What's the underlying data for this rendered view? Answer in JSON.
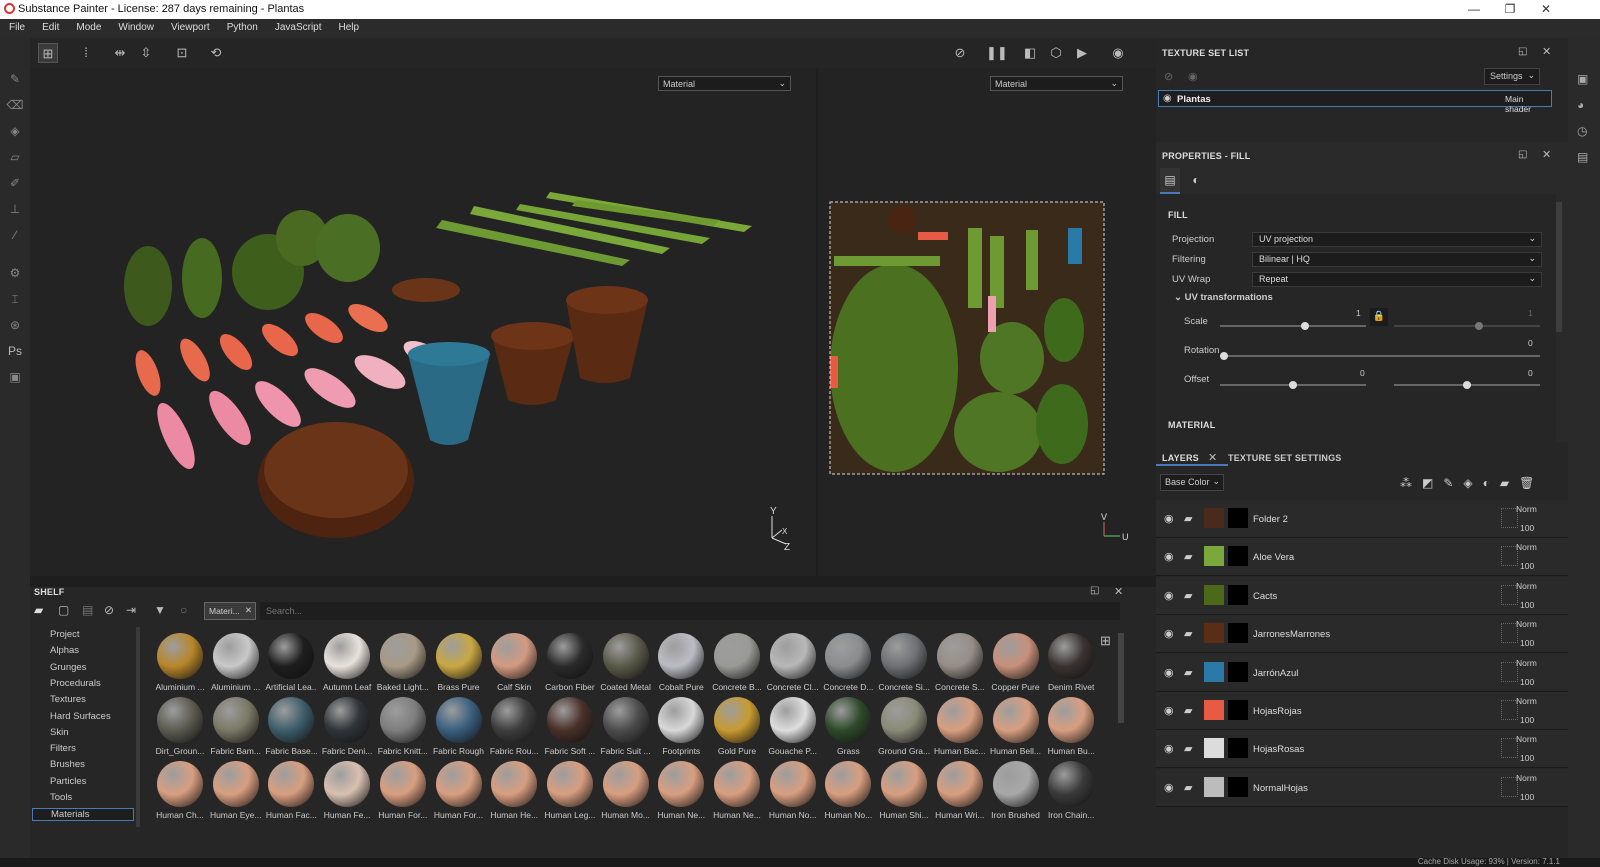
{
  "window": {
    "title": "Substance Painter - License: 287 days remaining - Plantas",
    "min": "—",
    "max": "❐",
    "close": "✕"
  },
  "menu": [
    "File",
    "Edit",
    "Mode",
    "Window",
    "Viewport",
    "Python",
    "JavaScript",
    "Help"
  ],
  "viewport": {
    "left_mode": "Material",
    "right_mode": "Material",
    "axis_y": "Y",
    "axis_x": "X",
    "axis_z": "Z",
    "axis_u": "U",
    "axis_v": "V"
  },
  "shelf": {
    "title": "SHELF",
    "filter_tag": "Materi...",
    "search_placeholder": "Search...",
    "categories": [
      "Project",
      "Alphas",
      "Grunges",
      "Procedurals",
      "Textures",
      "Hard Surfaces",
      "Skin",
      "Filters",
      "Brushes",
      "Particles",
      "Tools",
      "Materials"
    ],
    "selected_category": "Materials",
    "materials": [
      {
        "name": "Aluminium ...",
        "color": "#b8862a"
      },
      {
        "name": "Aluminium ...",
        "color": "#c9c9c9"
      },
      {
        "name": "Artificial Lea...",
        "color": "#1e1e1e"
      },
      {
        "name": "Autumn Leaf",
        "color": "#e8e2dc"
      },
      {
        "name": "Baked Light...",
        "color": "#a89a86"
      },
      {
        "name": "Brass Pure",
        "color": "#c9a742"
      },
      {
        "name": "Calf Skin",
        "color": "#d49a80"
      },
      {
        "name": "Carbon Fiber",
        "color": "#2a2a2a"
      },
      {
        "name": "Coated Metal",
        "color": "#5a5a4a"
      },
      {
        "name": "Cobalt Pure",
        "color": "#bcbcc4"
      },
      {
        "name": "Concrete B...",
        "color": "#9a9a96"
      },
      {
        "name": "Concrete Cl...",
        "color": "#b8b8b8"
      },
      {
        "name": "Concrete D...",
        "color": "#8a8c8e"
      },
      {
        "name": "Concrete Si...",
        "color": "#6e7074"
      },
      {
        "name": "Concrete S...",
        "color": "#968e86"
      },
      {
        "name": "Copper Pure",
        "color": "#c8907a"
      },
      {
        "name": "Denim Rivet",
        "color": "#3a3230"
      },
      {
        "name": "Dirt_Groun...",
        "color": "#5c5c52"
      },
      {
        "name": "Fabric Bam...",
        "color": "#7a7866"
      },
      {
        "name": "Fabric Base...",
        "color": "#3e5e6c"
      },
      {
        "name": "Fabric Deni...",
        "color": "#30353a"
      },
      {
        "name": "Fabric Knitt...",
        "color": "#7e7e7e"
      },
      {
        "name": "Fabric Rough",
        "color": "#3a5f80"
      },
      {
        "name": "Fabric Rou...",
        "color": "#3e3e3e"
      },
      {
        "name": "Fabric Soft ...",
        "color": "#4a3028"
      },
      {
        "name": "Fabric Suit ...",
        "color": "#4c4c4c"
      },
      {
        "name": "Footprints",
        "color": "#d8d8d8"
      },
      {
        "name": "Gold Pure",
        "color": "#c89a30"
      },
      {
        "name": "Gouache P...",
        "color": "#dedede"
      },
      {
        "name": "Grass",
        "color": "#2e4a2a"
      },
      {
        "name": "Ground Gra...",
        "color": "#8a8a78"
      },
      {
        "name": "Human Bac...",
        "color": "#d89e80"
      },
      {
        "name": "Human Bell...",
        "color": "#d89e80"
      },
      {
        "name": "Human Bu...",
        "color": "#d89e80"
      },
      {
        "name": "Human Ch...",
        "color": "#d89e80"
      },
      {
        "name": "Human Eye...",
        "color": "#d89e80"
      },
      {
        "name": "Human Fac...",
        "color": "#d89e80"
      },
      {
        "name": "Human Fe...",
        "color": "#d8c0b0"
      },
      {
        "name": "Human For...",
        "color": "#d89e80"
      },
      {
        "name": "Human For...",
        "color": "#d89e80"
      },
      {
        "name": "Human He...",
        "color": "#d89e80"
      },
      {
        "name": "Human Leg...",
        "color": "#d89e80"
      },
      {
        "name": "Human Mo...",
        "color": "#d89e80"
      },
      {
        "name": "Human Ne...",
        "color": "#d89e80"
      },
      {
        "name": "Human Ne...",
        "color": "#d89e80"
      },
      {
        "name": "Human No...",
        "color": "#d89e80"
      },
      {
        "name": "Human No...",
        "color": "#d89e80"
      },
      {
        "name": "Human Shi...",
        "color": "#d89e80"
      },
      {
        "name": "Human Wri...",
        "color": "#d89e80"
      },
      {
        "name": "Iron Brushed",
        "color": "#a8a8a8"
      },
      {
        "name": "Iron Chain...",
        "color": "#3a3a3a"
      }
    ]
  },
  "texture_set_list": {
    "title": "TEXTURE SET LIST",
    "settings": "Settings",
    "item_name": "Plantas",
    "item_shader": "Main shader"
  },
  "properties": {
    "title": "PROPERTIES - FILL",
    "section_fill": "FILL",
    "projection_label": "Projection",
    "projection_value": "UV projection",
    "filtering_label": "Filtering",
    "filtering_value": "Bilinear | HQ",
    "uvwrap_label": "UV Wrap",
    "uvwrap_value": "Repeat",
    "uv_transformations": "UV transformations",
    "scale_label": "Scale",
    "scale_value": "1",
    "scale_value2": "1",
    "rotation_label": "Rotation",
    "rotation_value": "0",
    "offset_label": "Offset",
    "offset_value_u": "0",
    "offset_value_v": "0",
    "section_material": "MATERIAL"
  },
  "layers_panel": {
    "tab_layers": "LAYERS",
    "tab_texture_settings": "TEXTURE SET SETTINGS",
    "channel": "Base Color",
    "layers": [
      {
        "name": "Folder 2",
        "color": "#4a2a1a",
        "blend": "Norm",
        "opacity": "100"
      },
      {
        "name": "Aloe Vera",
        "color": "#7aa83a",
        "blend": "Norm",
        "opacity": "100"
      },
      {
        "name": "Cacts",
        "color": "#4a6a1a",
        "blend": "Norm",
        "opacity": "100"
      },
      {
        "name": "JarronesMarrones",
        "color": "#5a2e14",
        "blend": "Norm",
        "opacity": "100"
      },
      {
        "name": "JarrónAzul",
        "color": "#2a7aa8",
        "blend": "Norm",
        "opacity": "100"
      },
      {
        "name": "HojasRojas",
        "color": "#e85a44",
        "blend": "Norm",
        "opacity": "100"
      },
      {
        "name": "HojasRosas",
        "color": "#dcdcdc",
        "blend": "Norm",
        "opacity": "100"
      },
      {
        "name": "NormalHojas",
        "color": "#bcbcbc",
        "blend": "Norm",
        "opacity": "100"
      }
    ]
  },
  "status": {
    "text": "Cache Disk Usage:  93% | Version: 7.1.1"
  }
}
